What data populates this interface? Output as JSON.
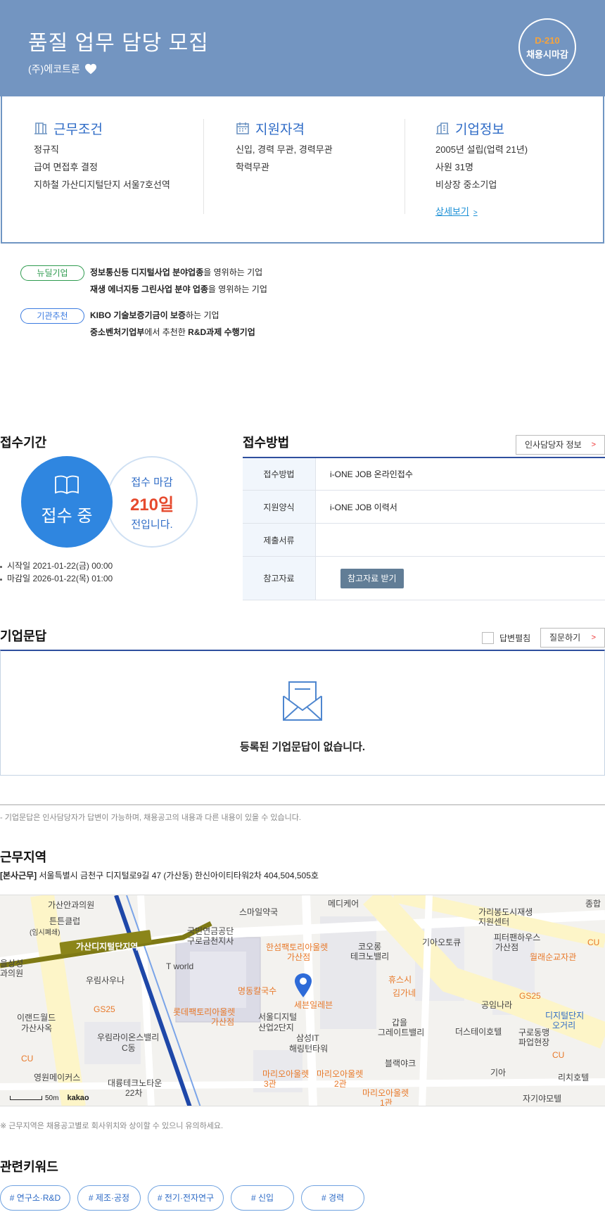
{
  "header": {
    "title": "품질 업무 담당 모집",
    "company": "(주)에코트론",
    "dday": "D-210",
    "deadline_badge": "채용시마감",
    "colors": {
      "hero": "#7395c1",
      "accent": "#f5a33d"
    }
  },
  "conditions": {
    "work": {
      "title": "근무조건",
      "lines": [
        "정규직",
        "급여 면접후 결정",
        "지하철 가산디지털단지 서울7호선역"
      ]
    },
    "qualification": {
      "title": "지원자격",
      "lines": [
        "신입, 경력 무관, 경력무관",
        "학력무관"
      ]
    },
    "company": {
      "title": "기업정보",
      "lines": [
        "2005년 설립(업력 21년)",
        "사원 31명",
        "비상장 중소기업"
      ],
      "more": "상세보기"
    }
  },
  "tags": [
    {
      "pill": "뉴딜기업",
      "line1_bold": "정보통신등 디지털사업 분야업종",
      "line1_rest": "을 영위하는 기업",
      "line2_bold": "재생 에너지등 그린사업 분야 업종",
      "line2_rest": "을 영위하는 기업"
    },
    {
      "pill": "기관추천",
      "line1_bold": "KIBO 기술보증기금이 보증",
      "line1_rest": "하는 기업",
      "line2_bold": "중소벤처기업부",
      "line2_mid": "에서 추천한 ",
      "line2_bold2": "R&D과제 수행기업"
    }
  ],
  "reception": {
    "period_title": "접수기간",
    "status": "접수 중",
    "remain_label": "접수 마감",
    "remain_days": "210일",
    "remain_suffix": "전입니다.",
    "start": "시작일 2021-01-22(금) 00:00",
    "end": "마감일 2026-01-22(목) 01:00",
    "method_title": "접수방법",
    "hr_button": "인사담당자 정보",
    "rows": [
      {
        "key": "접수방법",
        "value": "i-ONE JOB 온라인접수"
      },
      {
        "key": "지원양식",
        "value": "i-ONE JOB 이력서"
      },
      {
        "key": "제출서류",
        "value": ""
      },
      {
        "key": "참고자료",
        "button": "참고자료 받기"
      }
    ]
  },
  "qa": {
    "title": "기업문답",
    "toggle_label": "답변펼침",
    "ask_button": "질문하기",
    "empty": "등록된 기업문답이 없습니다.",
    "note": "- 기업문답은 인사담당자가 답변이 가능하며, 채용공고의 내용과 다른 내용이 있을 수 있습니다."
  },
  "location": {
    "title": "근무지역",
    "tag": "[본사근무]",
    "address": "서울특별시 금천구 디지털로9길 47 (가산동) 한신아이티타워2차 404,504,505호",
    "note": "※ 근무지역은 채용공고별로 회사위치와 상이할 수 있으니 유의하세요.",
    "map": {
      "labels": [
        "가산안과의원",
        "튼튼클럽",
        "(임시폐쇄)",
        "가산디지털단지역",
        "을상성",
        "과의원",
        "우림사우나",
        "GS25",
        "이랜드월드",
        "가산사옥",
        "우림라이온스밸리",
        "C동",
        "CU",
        "영원메이커스",
        "대륭테크노타운",
        "22차",
        "국민연금공단",
        "구로금천지사",
        "T world",
        "스마일약국",
        "메디케어",
        "한섬팩토리아울렛",
        "가산점",
        "명동칼국수",
        "롯데팩토리아울렛",
        "가산점",
        "서울디지털",
        "산업2단지",
        "세븐일레븐",
        "삼성IT",
        "해링턴타워",
        "마리오아울렛",
        "3관",
        "마리오아울렛",
        "2관",
        "마리오아울렛",
        "1관",
        "코오롱",
        "테크노밸리",
        "휴스시",
        "김가네",
        "갑을",
        "그레이트밸리",
        "블랙야크",
        "기아오토큐",
        "가리봉도시재생",
        "지원센터",
        "피터팬하우스",
        "가산점",
        "월래순교자관",
        "CU",
        "GS25",
        "종합",
        "공임나라",
        "더스테이호텔",
        "구로동맹",
        "파업현장",
        "디지털단지",
        "오거리",
        "CU",
        "기아",
        "리치호텔",
        "자기야모텔"
      ],
      "scale": "50m",
      "brand": "kakao"
    }
  },
  "keywords": {
    "title": "관련키워드",
    "items": [
      "# 연구소·R&D",
      "# 제조·공정",
      "# 전기·전자연구",
      "# 신입",
      "# 경력"
    ]
  }
}
